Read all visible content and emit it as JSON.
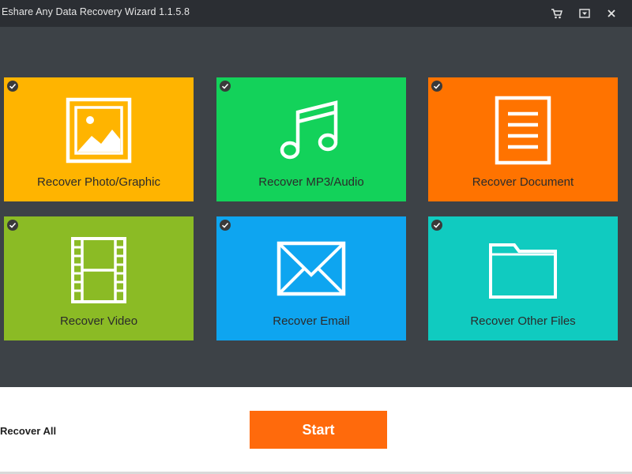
{
  "window": {
    "title": "Eshare Any Data Recovery Wizard 1.1.5.8"
  },
  "titlebar_icons": [
    "cart-icon",
    "dropdown-icon",
    "close-icon"
  ],
  "tiles": [
    {
      "label": "Recover Photo/Graphic",
      "color": "#ffb400",
      "icon": "photo-icon",
      "checked": true
    },
    {
      "label": "Recover MP3/Audio",
      "color": "#13d25a",
      "icon": "music-note-icon",
      "checked": true
    },
    {
      "label": "Recover Document",
      "color": "#ff7300",
      "icon": "document-icon",
      "checked": true
    },
    {
      "label": "Recover Video",
      "color": "#8bbb25",
      "icon": "film-strip-icon",
      "checked": true
    },
    {
      "label": "Recover Email",
      "color": "#0ea5f0",
      "icon": "envelope-icon",
      "checked": true
    },
    {
      "label": "Recover Other Files",
      "color": "#10cbc0",
      "icon": "folder-icon",
      "checked": true
    }
  ],
  "footer": {
    "recover_all_label": "Recover All",
    "start_label": "Start",
    "start_color": "#ff6a0c"
  }
}
